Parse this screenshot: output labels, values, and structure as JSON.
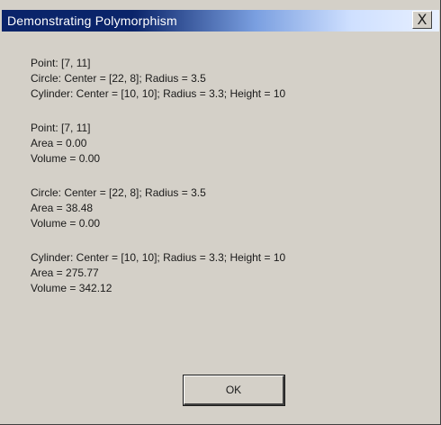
{
  "window": {
    "title": "Demonstrating Polymorphism",
    "close_glyph": "X"
  },
  "blocks": [
    {
      "lines": [
        "Point: [7, 11]",
        "Circle: Center = [22, 8]; Radius = 3.5",
        "Cylinder: Center = [10, 10]; Radius = 3.3; Height = 10"
      ]
    },
    {
      "lines": [
        "Point: [7, 11]",
        "Area = 0.00",
        "Volume = 0.00"
      ]
    },
    {
      "lines": [
        "Circle: Center = [22, 8]; Radius = 3.5",
        "Area = 38.48",
        "Volume = 0.00"
      ]
    },
    {
      "lines": [
        "Cylinder: Center = [10, 10]; Radius = 3.3; Height = 10",
        "Area = 275.77",
        "Volume = 342.12"
      ]
    }
  ],
  "buttons": {
    "ok_label": "OK"
  },
  "icons": {
    "close": "close-icon"
  },
  "colors": {
    "title_bar_start": "#0a246a",
    "title_bar_end": "#e8f0ff",
    "dialog_background": "#d4d0c8"
  }
}
